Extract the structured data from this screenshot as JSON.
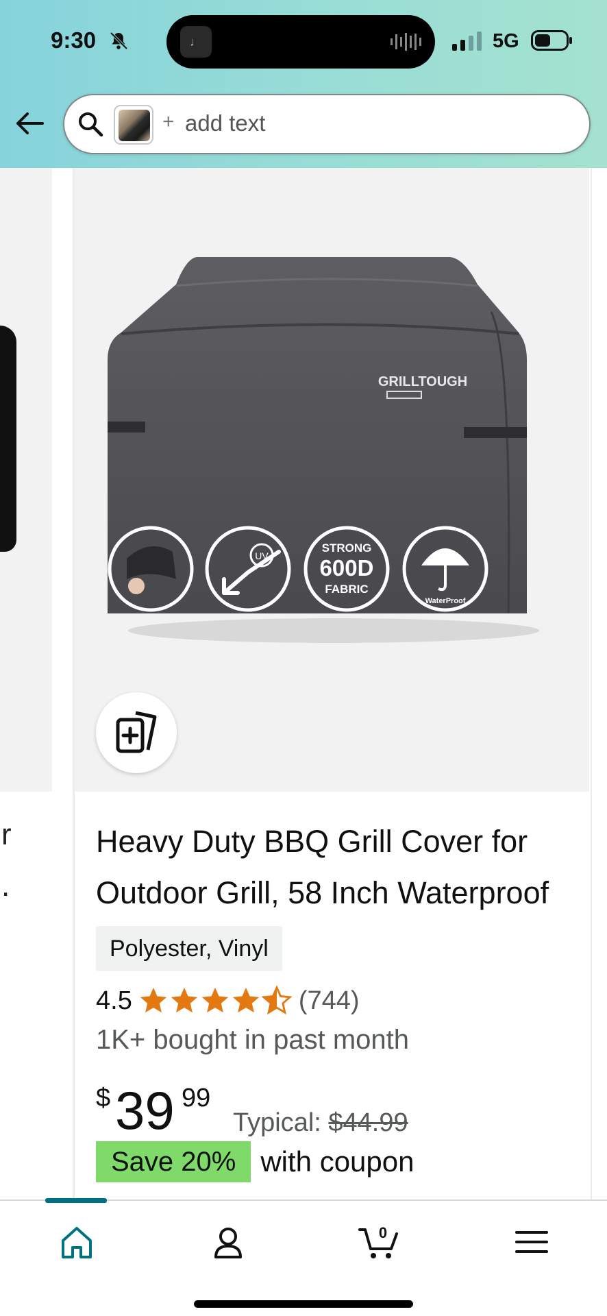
{
  "status_bar": {
    "time": "9:30",
    "network": "5G",
    "icons": [
      "bell-off-icon",
      "signal-icon",
      "battery-icon"
    ]
  },
  "search": {
    "plus": "+",
    "placeholder_text": "add text"
  },
  "side_card": {
    "fragment_1": "r",
    "fragment_2": "."
  },
  "product": {
    "brand_logo": "GRILLTOUGH",
    "badge_strong": "STRONG",
    "badge_600d": "600D",
    "badge_fabric": "FABRIC",
    "badge_uv": "UV",
    "badge_waterproof": "WaterProof",
    "title": "Heavy Duty BBQ Grill Cover for Outdoor Grill, 58 Inch Waterproof",
    "material": "Polyester, Vinyl",
    "rating": "4.5",
    "rating_value": 4.5,
    "reviews": "(744)",
    "bought": "1K+ bought in past month",
    "price_currency": "$",
    "price_whole": "39",
    "price_cents": "99",
    "typical_label": "Typical:",
    "typical_price": "$44.99",
    "save": "Save 20%",
    "coupon_text": "with coupon"
  },
  "bottom_nav": {
    "active": "home",
    "items": [
      "home-icon",
      "account-icon",
      "cart-icon",
      "menu-icon"
    ],
    "cart_count": "0"
  },
  "colors": {
    "accent": "#007185",
    "star": "#e47911",
    "save_badge": "#7fda69"
  }
}
